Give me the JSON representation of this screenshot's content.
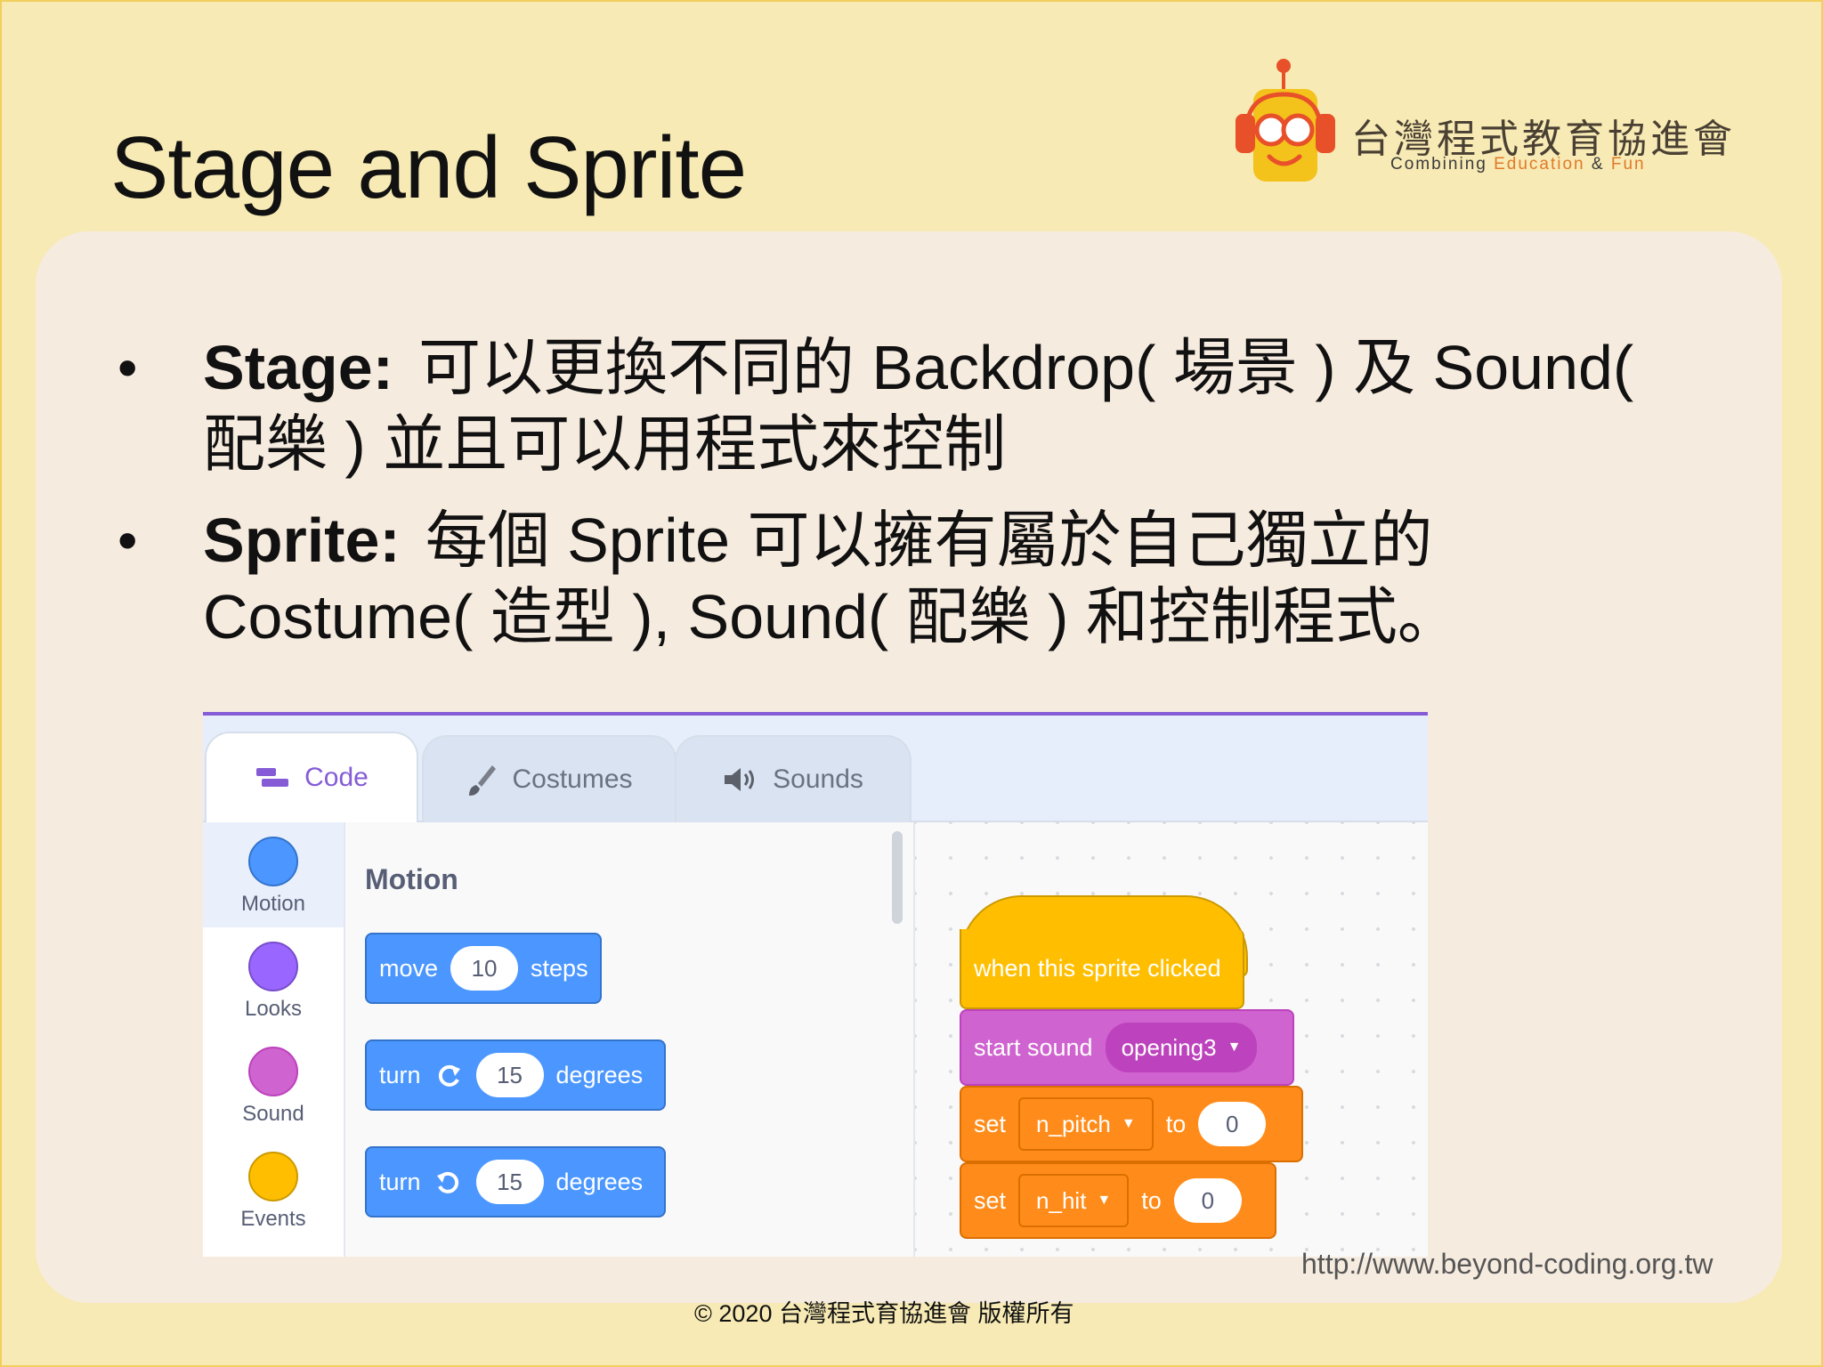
{
  "slide": {
    "title": "Stage and Sprite",
    "bullets": [
      {
        "term": "Stage:",
        "text": "可以更換不同的 Backdrop( 場景 ) 及 Sound( 配樂 ) 並且可以用程式來控制"
      },
      {
        "term": "Sprite:",
        "text": "每個 Sprite  可以擁有屬於自己獨立的 Costume( 造型 ), Sound( 配樂 ) 和控制程式。"
      }
    ],
    "url": "http://www.beyond-coding.org.tw",
    "copyright": "© 2020  台灣程式育協進會 版權所有"
  },
  "logo": {
    "name_cn": "台灣程式教育協進會",
    "tagline_1": "Combining ",
    "tagline_2": "Education",
    "tagline_3": " & ",
    "tagline_4": "Fun"
  },
  "scratch": {
    "tabs": [
      {
        "label": "Code",
        "icon": "code-icon",
        "active": true
      },
      {
        "label": "Costumes",
        "icon": "brush-icon",
        "active": false
      },
      {
        "label": "Sounds",
        "icon": "speaker-icon",
        "active": false
      }
    ],
    "categories": [
      {
        "label": "Motion",
        "color": "#4c97ff",
        "selected": true
      },
      {
        "label": "Looks",
        "color": "#9966ff",
        "selected": false
      },
      {
        "label": "Sound",
        "color": "#cf63cf",
        "selected": false
      },
      {
        "label": "Events",
        "color": "#ffbf00",
        "selected": false
      }
    ],
    "palette": {
      "title": "Motion",
      "blocks": [
        {
          "word1": "move",
          "value": "10",
          "word2": "steps"
        },
        {
          "word1": "turn",
          "icon": "rotate-right-icon",
          "value": "15",
          "word2": "degrees"
        },
        {
          "word1": "turn",
          "icon": "rotate-left-icon",
          "value": "15",
          "word2": "degrees"
        }
      ]
    },
    "script": {
      "hat": "when this sprite clicked",
      "sound_block": {
        "label": "start sound",
        "option": "opening3"
      },
      "set_blocks": [
        {
          "label": "set",
          "variable": "n_pitch",
          "to": "to",
          "value": "0"
        },
        {
          "label": "set",
          "variable": "n_hit",
          "to": "to",
          "value": "0"
        }
      ]
    }
  },
  "colors": {
    "background": "#f7eab4",
    "panel": "#f6ebdf",
    "scratch_accent": "#855cd6",
    "motion": "#4c97ff",
    "events": "#ffbf00",
    "sound": "#cf63cf",
    "variables": "#ff8c1a"
  }
}
